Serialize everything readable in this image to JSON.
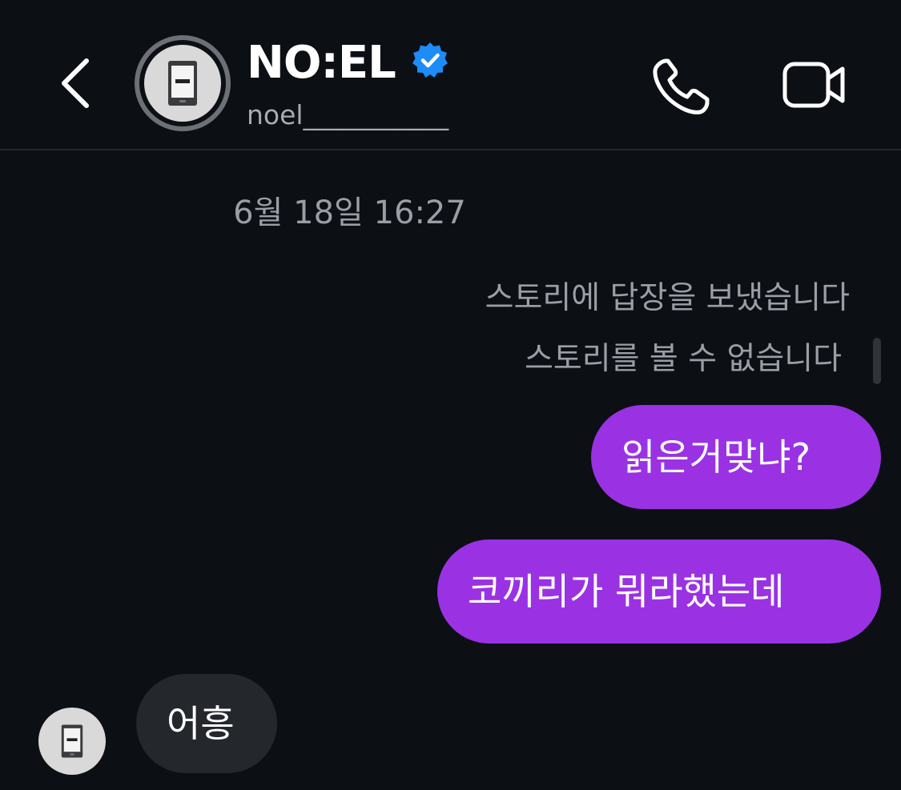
{
  "header": {
    "display_name": "NO:EL",
    "username": "noel___________",
    "verified": true,
    "icons": {
      "back": "chevron-left-icon",
      "verified": "verified-badge-icon",
      "call": "phone-icon",
      "video": "video-camera-icon"
    },
    "colors": {
      "verified": "#1d8cf8"
    }
  },
  "thread": {
    "timestamp": "6월 18일 16:27",
    "notes": [
      "스토리에 답장을 보냈습니다",
      "스토리를 볼 수 없습니다"
    ],
    "messages": [
      {
        "direction": "outgoing",
        "text": "읽은거맞냐?"
      },
      {
        "direction": "outgoing",
        "text": "코끼리가 뭐라했는데"
      },
      {
        "direction": "incoming",
        "text": "어흥"
      }
    ],
    "colors": {
      "background": "#0c0f14",
      "outgoing_bubble": "#9a32e4",
      "incoming_bubble": "#24272c",
      "muted_text": "#9a9ea6"
    }
  }
}
